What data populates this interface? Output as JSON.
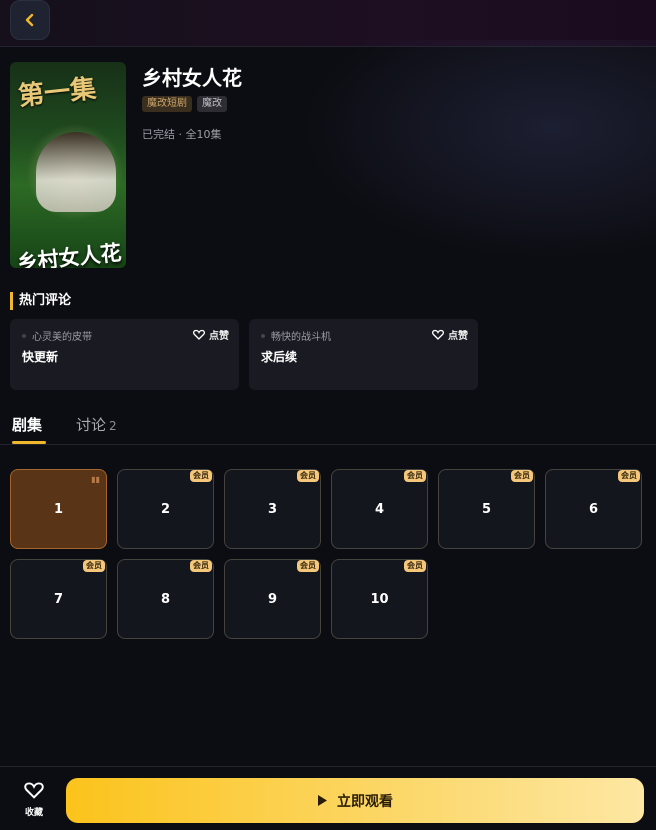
{
  "nav": {
    "back_icon": "chevron-left-icon"
  },
  "drama": {
    "title": "乡村女人花",
    "cover_badge": "第一集",
    "cover_title": "乡村女人花",
    "tags": [
      "魔改短剧",
      "魔改"
    ],
    "status": "已完结 · 全10集"
  },
  "comments_section": {
    "title": "热门评论",
    "items": [
      {
        "user": "心灵美的皮带",
        "text": "快更新",
        "like_label": "点赞"
      },
      {
        "user": "畅快的战斗机",
        "text": "求后续",
        "like_label": "点赞"
      }
    ]
  },
  "tabs": [
    {
      "label": "剧集",
      "active": true
    },
    {
      "label": "讨论",
      "count": "2",
      "active": false
    }
  ],
  "episodes": [
    {
      "num": "1",
      "badge": "",
      "playing": true
    },
    {
      "num": "2",
      "badge": "会员"
    },
    {
      "num": "3",
      "badge": "会员"
    },
    {
      "num": "4",
      "badge": "会员"
    },
    {
      "num": "5",
      "badge": "会员"
    },
    {
      "num": "6",
      "badge": "会员"
    },
    {
      "num": "7",
      "badge": "会员"
    },
    {
      "num": "8",
      "badge": "会员"
    },
    {
      "num": "9",
      "badge": "会员"
    },
    {
      "num": "10",
      "badge": "会员"
    }
  ],
  "bottom_bar": {
    "favorite_label": "收藏",
    "watch_label": "立即观看"
  },
  "colors": {
    "accent": "#f1b72a",
    "vip_badge": "#f5c77a",
    "active_episode": "#5a3417"
  }
}
